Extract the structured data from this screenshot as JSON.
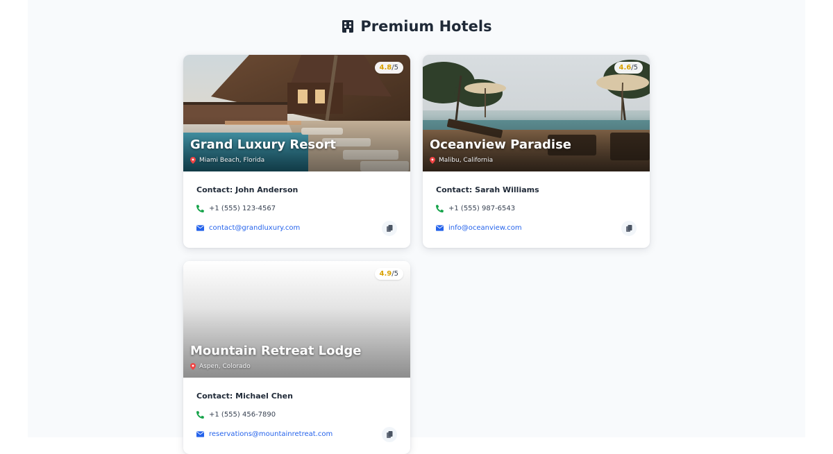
{
  "page": {
    "title": "Premium Hotels",
    "title_icon": "building-icon"
  },
  "hotels": [
    {
      "name": "Grand Luxury Resort",
      "location": "Miami Beach, Florida",
      "rating_score": "4.8",
      "rating_max": "/5",
      "contact_label": "Contact: John Anderson",
      "phone": "+1 (555) 123-4567",
      "email": "contact@grandluxury.com",
      "image": "resort-pool-photo"
    },
    {
      "name": "Oceanview Paradise",
      "location": "Malibu, California",
      "rating_score": "4.6",
      "rating_max": "/5",
      "contact_label": "Contact: Sarah Williams",
      "phone": "+1 (555) 987-6543",
      "email": "info@oceanview.com",
      "image": "ocean-deck-photo"
    },
    {
      "name": "Mountain Retreat Lodge",
      "location": "Aspen, Colorado",
      "rating_score": "4.9",
      "rating_max": "/5",
      "contact_label": "Contact: Michael Chen",
      "phone": "+1 (555) 456-7890",
      "email": "reservations@mountainretreat.com",
      "image": "image-not-loaded"
    }
  ],
  "icons": {
    "phone": "phone-icon",
    "email": "envelope-icon",
    "location": "map-pin-icon",
    "copy": "copy-icon"
  },
  "colors": {
    "rating_accent": "#d9a100",
    "phone_icon": "#16a34a",
    "link": "#2563eb",
    "pin": "#ef4444"
  }
}
